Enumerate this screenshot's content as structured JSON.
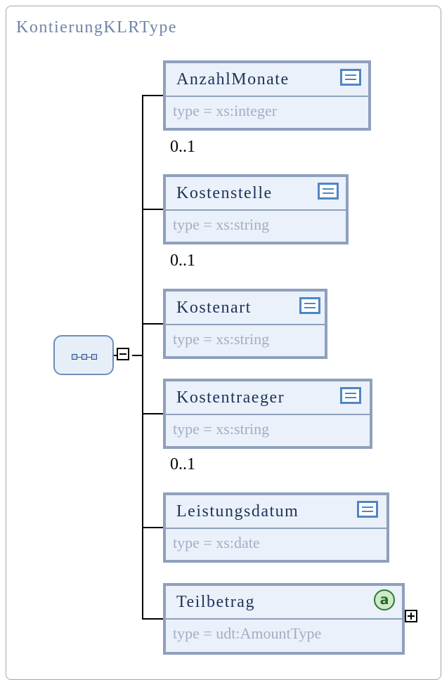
{
  "diagram": {
    "title": "KontierungKLRType",
    "elements": [
      {
        "name": "AnzahlMonate",
        "type": "type = xs:integer",
        "occurrence": "0..1",
        "icon": "documentation-icon"
      },
      {
        "name": "Kostenstelle",
        "type": "type = xs:string",
        "occurrence": "0..1",
        "icon": "documentation-icon"
      },
      {
        "name": "Kostenart",
        "type": "type = xs:string",
        "occurrence": "",
        "icon": "documentation-icon"
      },
      {
        "name": "Kostentraeger",
        "type": "type = xs:string",
        "occurrence": "0..1",
        "icon": "documentation-icon"
      },
      {
        "name": "Leistungsdatum",
        "type": "type = xs:date",
        "occurrence": "",
        "icon": "documentation-icon"
      },
      {
        "name": "Teilbetrag",
        "type": "type = udt:AmountType",
        "occurrence": "",
        "icon": "attribute-icon",
        "icon_text": "a"
      }
    ],
    "colors": {
      "box_border": "#8fa0bd",
      "box_fill": "#eaf1fa",
      "name_text": "#1f3258",
      "type_text": "#a3afc2",
      "title_text": "#6f84a8"
    }
  }
}
